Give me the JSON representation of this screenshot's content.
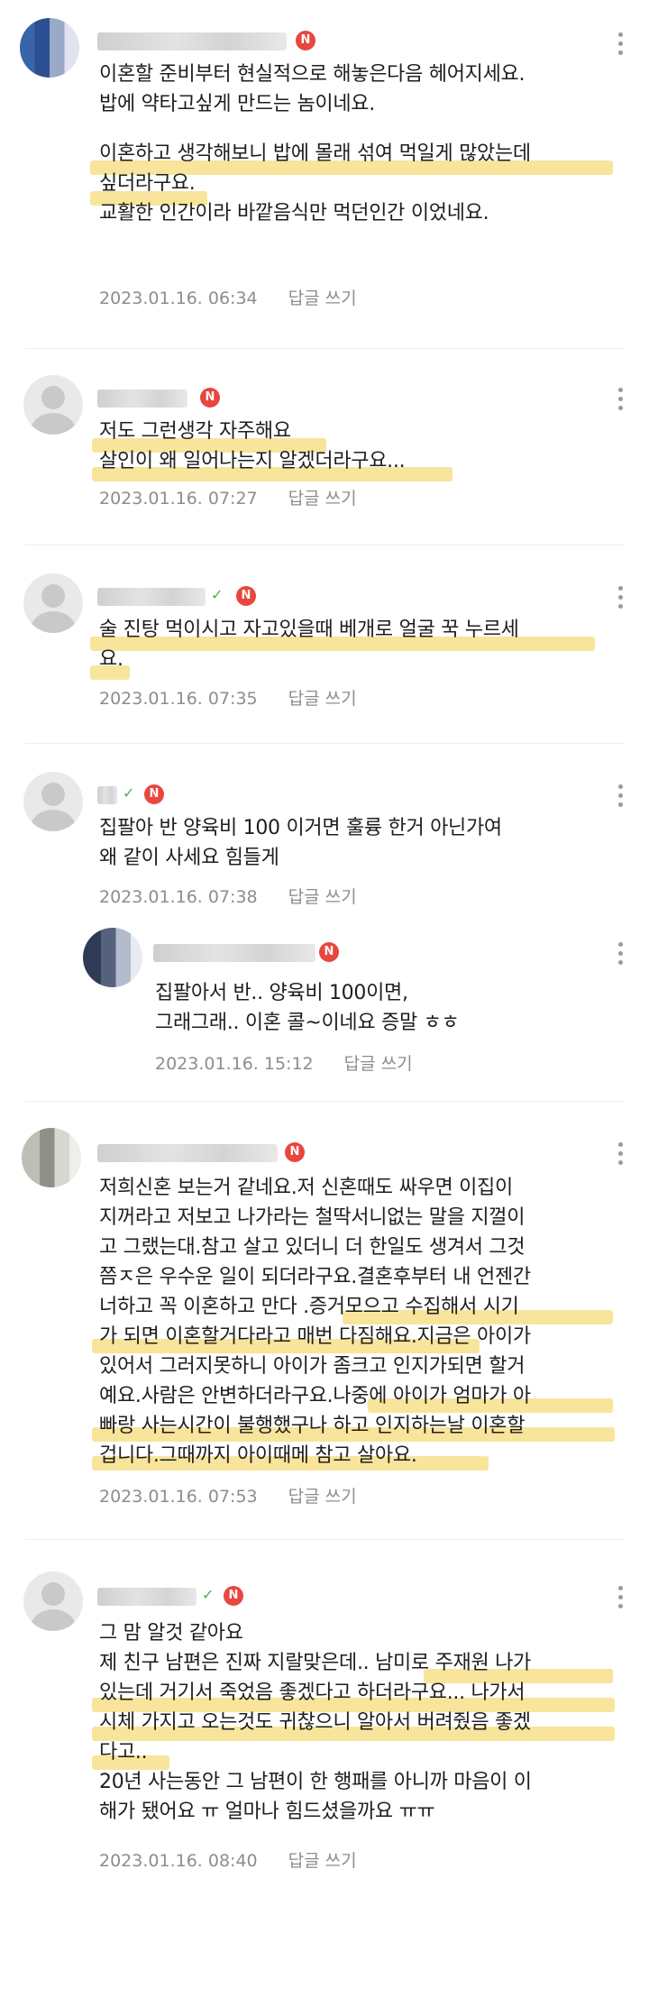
{
  "comments": [
    {
      "lines": [
        "이혼할 준비부터 현실적으로 해놓은다음 헤어지세요.",
        "밥에 약타고싶게 만드는 놈이네요.",
        "",
        "이혼하고 생각해보니 밥에 몰래 섞여 먹일게 많았는데",
        "싶더라구요.",
        "교활한 인간이라 바깥음식만 먹던인간 이었네요."
      ],
      "date": "2023.01.16. 06:34",
      "reply": "답글 쓰기"
    },
    {
      "lines": [
        "저도 그런생각 자주해요",
        "살인이 왜 일어나는지 알겠더라구요..."
      ],
      "date": "2023.01.16. 07:27",
      "reply": "답글 쓰기"
    },
    {
      "lines": [
        "술 진탕 먹이시고 자고있을때 베개로 얼굴 꾹 누르세",
        "요."
      ],
      "date": "2023.01.16. 07:35",
      "reply": "답글 쓰기"
    },
    {
      "lines": [
        "집팔아 반 양육비 100 이거면 훌륭 한거 아닌가여",
        "왜 같이 사세요 힘들게"
      ],
      "date": "2023.01.16. 07:38",
      "reply": "답글 쓰기"
    },
    {
      "lines": [
        "집팔아서 반.. 양육비 100이면,",
        "그래그래.. 이혼 콜~이네요 증말 ㅎㅎ"
      ],
      "date": "2023.01.16. 15:12",
      "reply": "답글 쓰기"
    },
    {
      "lines": [
        "저희신혼 보는거 같네요.저 신혼때도 싸우면 이집이",
        "지꺼라고 저보고 나가라는 철딱서니없는 말을 지껄이",
        "고 그랬는대.참고 살고 있더니 더 한일도 생겨서 그것",
        "쯤ㅈ은 우수운 일이 되더라구요.결혼후부터 내 언젠간",
        "너하고 꼭 이혼하고 만다 .증거모으고 수집해서 시기",
        "가 되면 이혼할거다라고 매번 다짐해요.지금은 아이가",
        "있어서 그러지못하니 아이가 좀크고 인지가되면 할거",
        "예요.사람은 안변하더라구요.나중에 아이가 엄마가 아",
        "빠랑 사는시간이 불행했구나 하고 인지하는날 이혼할",
        "겁니다.그때까지 아이때메 참고 살아요."
      ],
      "date": "2023.01.16. 07:53",
      "reply": "답글 쓰기"
    },
    {
      "lines": [
        "그 맘 알것 같아요",
        "제 친구 남편은 진짜 지랄맞은데.. 남미로 주재원 나가",
        "있는데 거기서 죽었음 좋겠다고 하더라구요... 나가서",
        "시체 가지고 오는것도 귀찮으니 알아서 버려줬음 좋겠",
        "다고..",
        "20년 사는동안 그 남편이 한 행패를 아니까 마음이 이",
        "해가 됐어요 ㅠ 얼마나 힘드셨을까요 ㅠㅠ"
      ],
      "date": "2023.01.16. 08:40",
      "reply": "답글 쓰기"
    }
  ],
  "badge": "N",
  "colors": {
    "highlight": "#f6dc7a",
    "badge": "#e8473f",
    "meta": "#8d8d8d"
  }
}
